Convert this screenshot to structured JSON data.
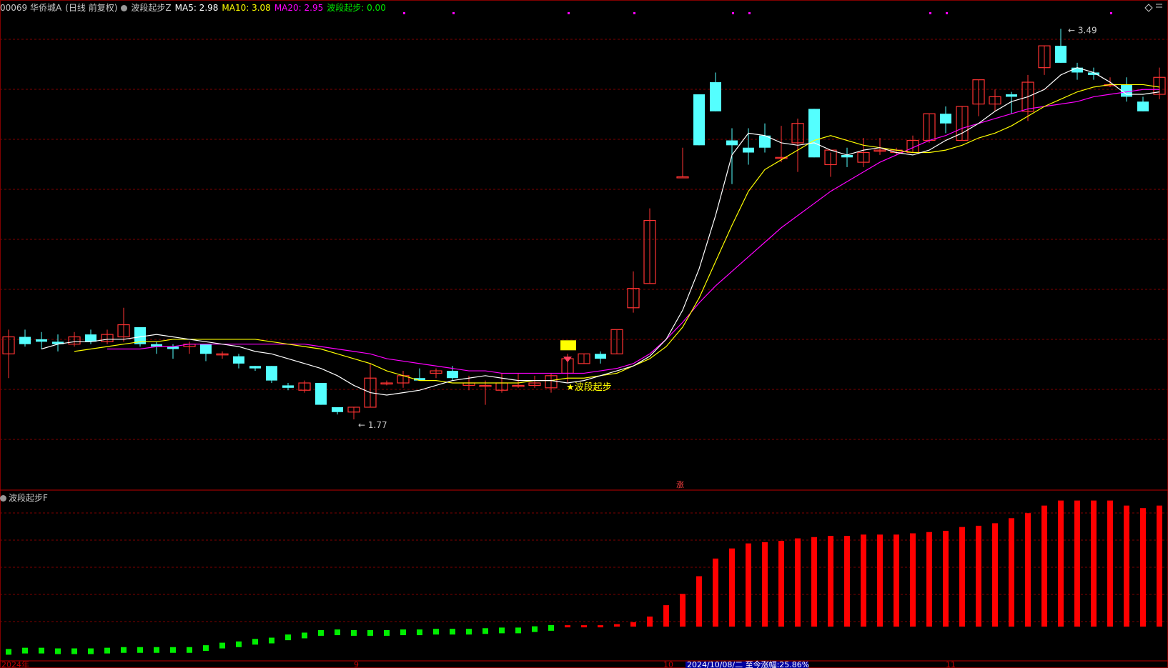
{
  "header": {
    "code_name": "00069 华侨城A",
    "mode": "(日线 前复权)",
    "indicator": "波段起步Z",
    "ma5": "MA5: 2.98",
    "ma10": "MA10: 3.08",
    "ma20": "MA20: 2.95",
    "bdqb": "波段起步: 0.00"
  },
  "sub_header": {
    "label": "波段起步F"
  },
  "colors": {
    "background": "#000000",
    "up": "#ff3333",
    "down": "#54ffff",
    "ma5": "#ffffff",
    "ma10": "#ffff00",
    "ma20": "#ff00ff",
    "grid": "#800000",
    "neg_bar": "#00ee00",
    "pos_bar": "#ff0000"
  },
  "chart_data": [
    {
      "type": "candlestick",
      "ylim": [
        1.6,
        3.55
      ],
      "max_label": "3.49",
      "min_label": "1.77",
      "signal_label": "★波段起步",
      "rise_marker": "涨",
      "ohlc": [
        [
          2.15,
          2.25,
          2.05,
          2.22
        ],
        [
          2.22,
          2.25,
          2.18,
          2.19
        ],
        [
          2.21,
          2.24,
          2.17,
          2.2
        ],
        [
          2.2,
          2.23,
          2.16,
          2.19
        ],
        [
          2.19,
          2.24,
          2.18,
          2.22
        ],
        [
          2.23,
          2.25,
          2.19,
          2.2
        ],
        [
          2.2,
          2.25,
          2.19,
          2.23
        ],
        [
          2.22,
          2.34,
          2.2,
          2.27
        ],
        [
          2.26,
          2.26,
          2.18,
          2.19
        ],
        [
          2.19,
          2.2,
          2.15,
          2.18
        ],
        [
          2.18,
          2.19,
          2.13,
          2.17
        ],
        [
          2.18,
          2.2,
          2.15,
          2.19
        ],
        [
          2.19,
          2.19,
          2.12,
          2.15
        ],
        [
          2.15,
          2.16,
          2.13,
          2.15
        ],
        [
          2.14,
          2.15,
          2.09,
          2.11
        ],
        [
          2.1,
          2.1,
          2.08,
          2.09
        ],
        [
          2.1,
          2.1,
          2.03,
          2.04
        ],
        [
          2.02,
          2.03,
          2.0,
          2.01
        ],
        [
          2.0,
          2.04,
          1.99,
          2.03
        ],
        [
          2.03,
          2.03,
          1.94,
          1.94
        ],
        [
          1.93,
          1.93,
          1.9,
          1.91
        ],
        [
          1.91,
          1.93,
          1.88,
          1.93
        ],
        [
          1.93,
          2.11,
          1.93,
          2.05
        ],
        [
          2.03,
          2.04,
          2.02,
          2.03
        ],
        [
          2.03,
          2.08,
          2.01,
          2.06
        ],
        [
          2.05,
          2.09,
          2.04,
          2.04
        ],
        [
          2.07,
          2.09,
          2.05,
          2.08
        ],
        [
          2.08,
          2.1,
          2.04,
          2.05
        ],
        [
          2.02,
          2.06,
          2.0,
          2.03
        ],
        [
          2.02,
          2.04,
          1.94,
          2.02
        ],
        [
          2.0,
          2.07,
          1.99,
          2.03
        ],
        [
          2.02,
          2.07,
          2.01,
          2.02
        ],
        [
          2.02,
          2.06,
          2.01,
          2.03
        ],
        [
          2.01,
          2.07,
          1.99,
          2.06
        ],
        [
          2.07,
          2.15,
          2.03,
          2.13
        ],
        [
          2.11,
          2.15,
          2.11,
          2.15
        ],
        [
          2.15,
          2.16,
          2.11,
          2.13
        ],
        [
          2.15,
          2.25,
          2.15,
          2.25
        ],
        [
          2.34,
          2.49,
          2.32,
          2.42
        ],
        [
          2.44,
          2.75,
          2.44,
          2.7
        ],
        [
          null,
          null,
          null,
          null
        ],
        [
          2.88,
          3.0,
          2.88,
          2.88
        ],
        [
          3.22,
          3.22,
          3.01,
          3.01
        ],
        [
          3.27,
          3.31,
          3.15,
          3.15
        ],
        [
          3.03,
          3.08,
          2.85,
          3.01
        ],
        [
          3.0,
          3.08,
          2.93,
          2.98
        ],
        [
          3.05,
          3.1,
          2.98,
          3.0
        ],
        [
          2.96,
          3.09,
          2.94,
          2.96
        ],
        [
          3.02,
          3.12,
          2.9,
          3.1
        ],
        [
          3.16,
          3.16,
          2.96,
          2.96
        ],
        [
          2.93,
          2.98,
          2.88,
          2.99
        ],
        [
          2.97,
          3.0,
          2.92,
          2.96
        ],
        [
          2.94,
          3.04,
          2.92,
          2.98
        ],
        [
          2.99,
          3.04,
          2.97,
          2.99
        ],
        [
          2.98,
          3.0,
          2.97,
          2.99
        ],
        [
          2.98,
          3.05,
          2.98,
          3.03
        ],
        [
          3.03,
          3.14,
          3.02,
          3.14
        ],
        [
          3.14,
          3.17,
          3.06,
          3.1
        ],
        [
          3.03,
          3.17,
          3.03,
          3.17
        ],
        [
          3.18,
          3.28,
          3.13,
          3.28
        ],
        [
          3.18,
          3.24,
          3.15,
          3.21
        ],
        [
          3.22,
          3.23,
          3.14,
          3.21
        ],
        [
          3.15,
          3.3,
          3.11,
          3.27
        ],
        [
          3.33,
          3.42,
          3.3,
          3.42
        ],
        [
          3.42,
          3.49,
          3.35,
          3.35
        ],
        [
          3.33,
          3.35,
          3.28,
          3.31
        ],
        [
          3.31,
          3.33,
          3.28,
          3.3
        ],
        [
          3.26,
          3.29,
          3.25,
          3.26
        ],
        [
          3.26,
          3.29,
          3.19,
          3.21
        ],
        [
          3.19,
          3.21,
          3.15,
          3.15
        ],
        [
          3.22,
          3.33,
          3.2,
          3.29
        ]
      ],
      "ma5": [
        2.17,
        2.19,
        2.2,
        2.2,
        2.21,
        2.21,
        2.22,
        2.23,
        2.22,
        2.21,
        2.2,
        2.19,
        2.18,
        2.16,
        2.15,
        2.13,
        2.11,
        2.09,
        2.06,
        2.02,
        1.99,
        1.98,
        1.99,
        2.0,
        2.02,
        2.04,
        2.05,
        2.06,
        2.05,
        2.04,
        2.04,
        2.04,
        2.03,
        2.04,
        2.06,
        2.08,
        2.1,
        2.14,
        2.21,
        2.33,
        2.5,
        2.72,
        2.97,
        3.06,
        3.05,
        3.02,
        3.01,
        3.02,
        2.99,
        2.97,
        2.99,
        3.0,
        2.98,
        2.97,
        2.99,
        3.03,
        3.06,
        3.1,
        3.15,
        3.19,
        3.21,
        3.24,
        3.3,
        3.33,
        3.31,
        3.27,
        3.22,
        3.22,
        3.23
      ],
      "ma10": [
        2.16,
        2.17,
        2.18,
        2.19,
        2.2,
        2.2,
        2.21,
        2.21,
        2.21,
        2.21,
        2.21,
        2.21,
        2.2,
        2.19,
        2.18,
        2.17,
        2.15,
        2.13,
        2.11,
        2.08,
        2.06,
        2.04,
        2.04,
        2.03,
        2.03,
        2.03,
        2.03,
        2.03,
        2.04,
        2.04,
        2.05,
        2.05,
        2.06,
        2.07,
        2.1,
        2.13,
        2.18,
        2.26,
        2.38,
        2.53,
        2.68,
        2.82,
        2.91,
        2.95,
        2.99,
        3.03,
        3.05,
        3.03,
        3.01,
        3.0,
        2.99,
        2.98,
        2.98,
        2.99,
        3.01,
        3.04,
        3.06,
        3.09,
        3.13,
        3.17,
        3.2,
        3.23,
        3.25,
        3.26,
        3.26,
        3.26,
        3.25
      ],
      "ma20": [
        2.17,
        2.17,
        2.17,
        2.18,
        2.18,
        2.19,
        2.19,
        2.19,
        2.19,
        2.19,
        2.19,
        2.19,
        2.19,
        2.18,
        2.17,
        2.16,
        2.15,
        2.13,
        2.12,
        2.11,
        2.1,
        2.09,
        2.08,
        2.08,
        2.07,
        2.07,
        2.07,
        2.07,
        2.07,
        2.07,
        2.08,
        2.09,
        2.11,
        2.15,
        2.21,
        2.28,
        2.36,
        2.43,
        2.49,
        2.55,
        2.61,
        2.67,
        2.72,
        2.77,
        2.82,
        2.86,
        2.9,
        2.94,
        2.97,
        3.0,
        3.03,
        3.05,
        3.08,
        3.1,
        3.12,
        3.14,
        3.16,
        3.17,
        3.18,
        3.19,
        3.21,
        3.22,
        3.23,
        3.24,
        3.24
      ]
    },
    {
      "type": "bar",
      "title": "波段起步F",
      "values": [
        -2.0,
        -1.9,
        -1.9,
        -1.95,
        -1.95,
        -1.95,
        -1.9,
        -1.85,
        -1.85,
        -1.85,
        -1.85,
        -1.85,
        -1.7,
        -1.5,
        -1.4,
        -1.2,
        -1.1,
        -0.85,
        -0.7,
        -0.5,
        -0.45,
        -0.5,
        -0.5,
        -0.5,
        -0.45,
        -0.45,
        -0.4,
        -0.4,
        -0.4,
        -0.35,
        -0.3,
        -0.3,
        -0.2,
        -0.1,
        0,
        0,
        0,
        0.2,
        0.35,
        0.8,
        1.7,
        2.6,
        4.0,
        5.4,
        6.2,
        6.6,
        6.7,
        6.8,
        7.0,
        7.1,
        7.2,
        7.2,
        7.3,
        7.3,
        7.3,
        7.4,
        7.5,
        7.6,
        7.9,
        8.0,
        8.2,
        8.6,
        9.0,
        9.6,
        10.0,
        10.0,
        10.0,
        10.0,
        9.6,
        9.4,
        9.6
      ],
      "ylim": [
        -2.6,
        10.6
      ]
    }
  ],
  "axis": {
    "labels": [
      "2024年",
      "9",
      "10",
      "2024/10/08/二 至今涨幅:25.86%",
      "11"
    ]
  }
}
